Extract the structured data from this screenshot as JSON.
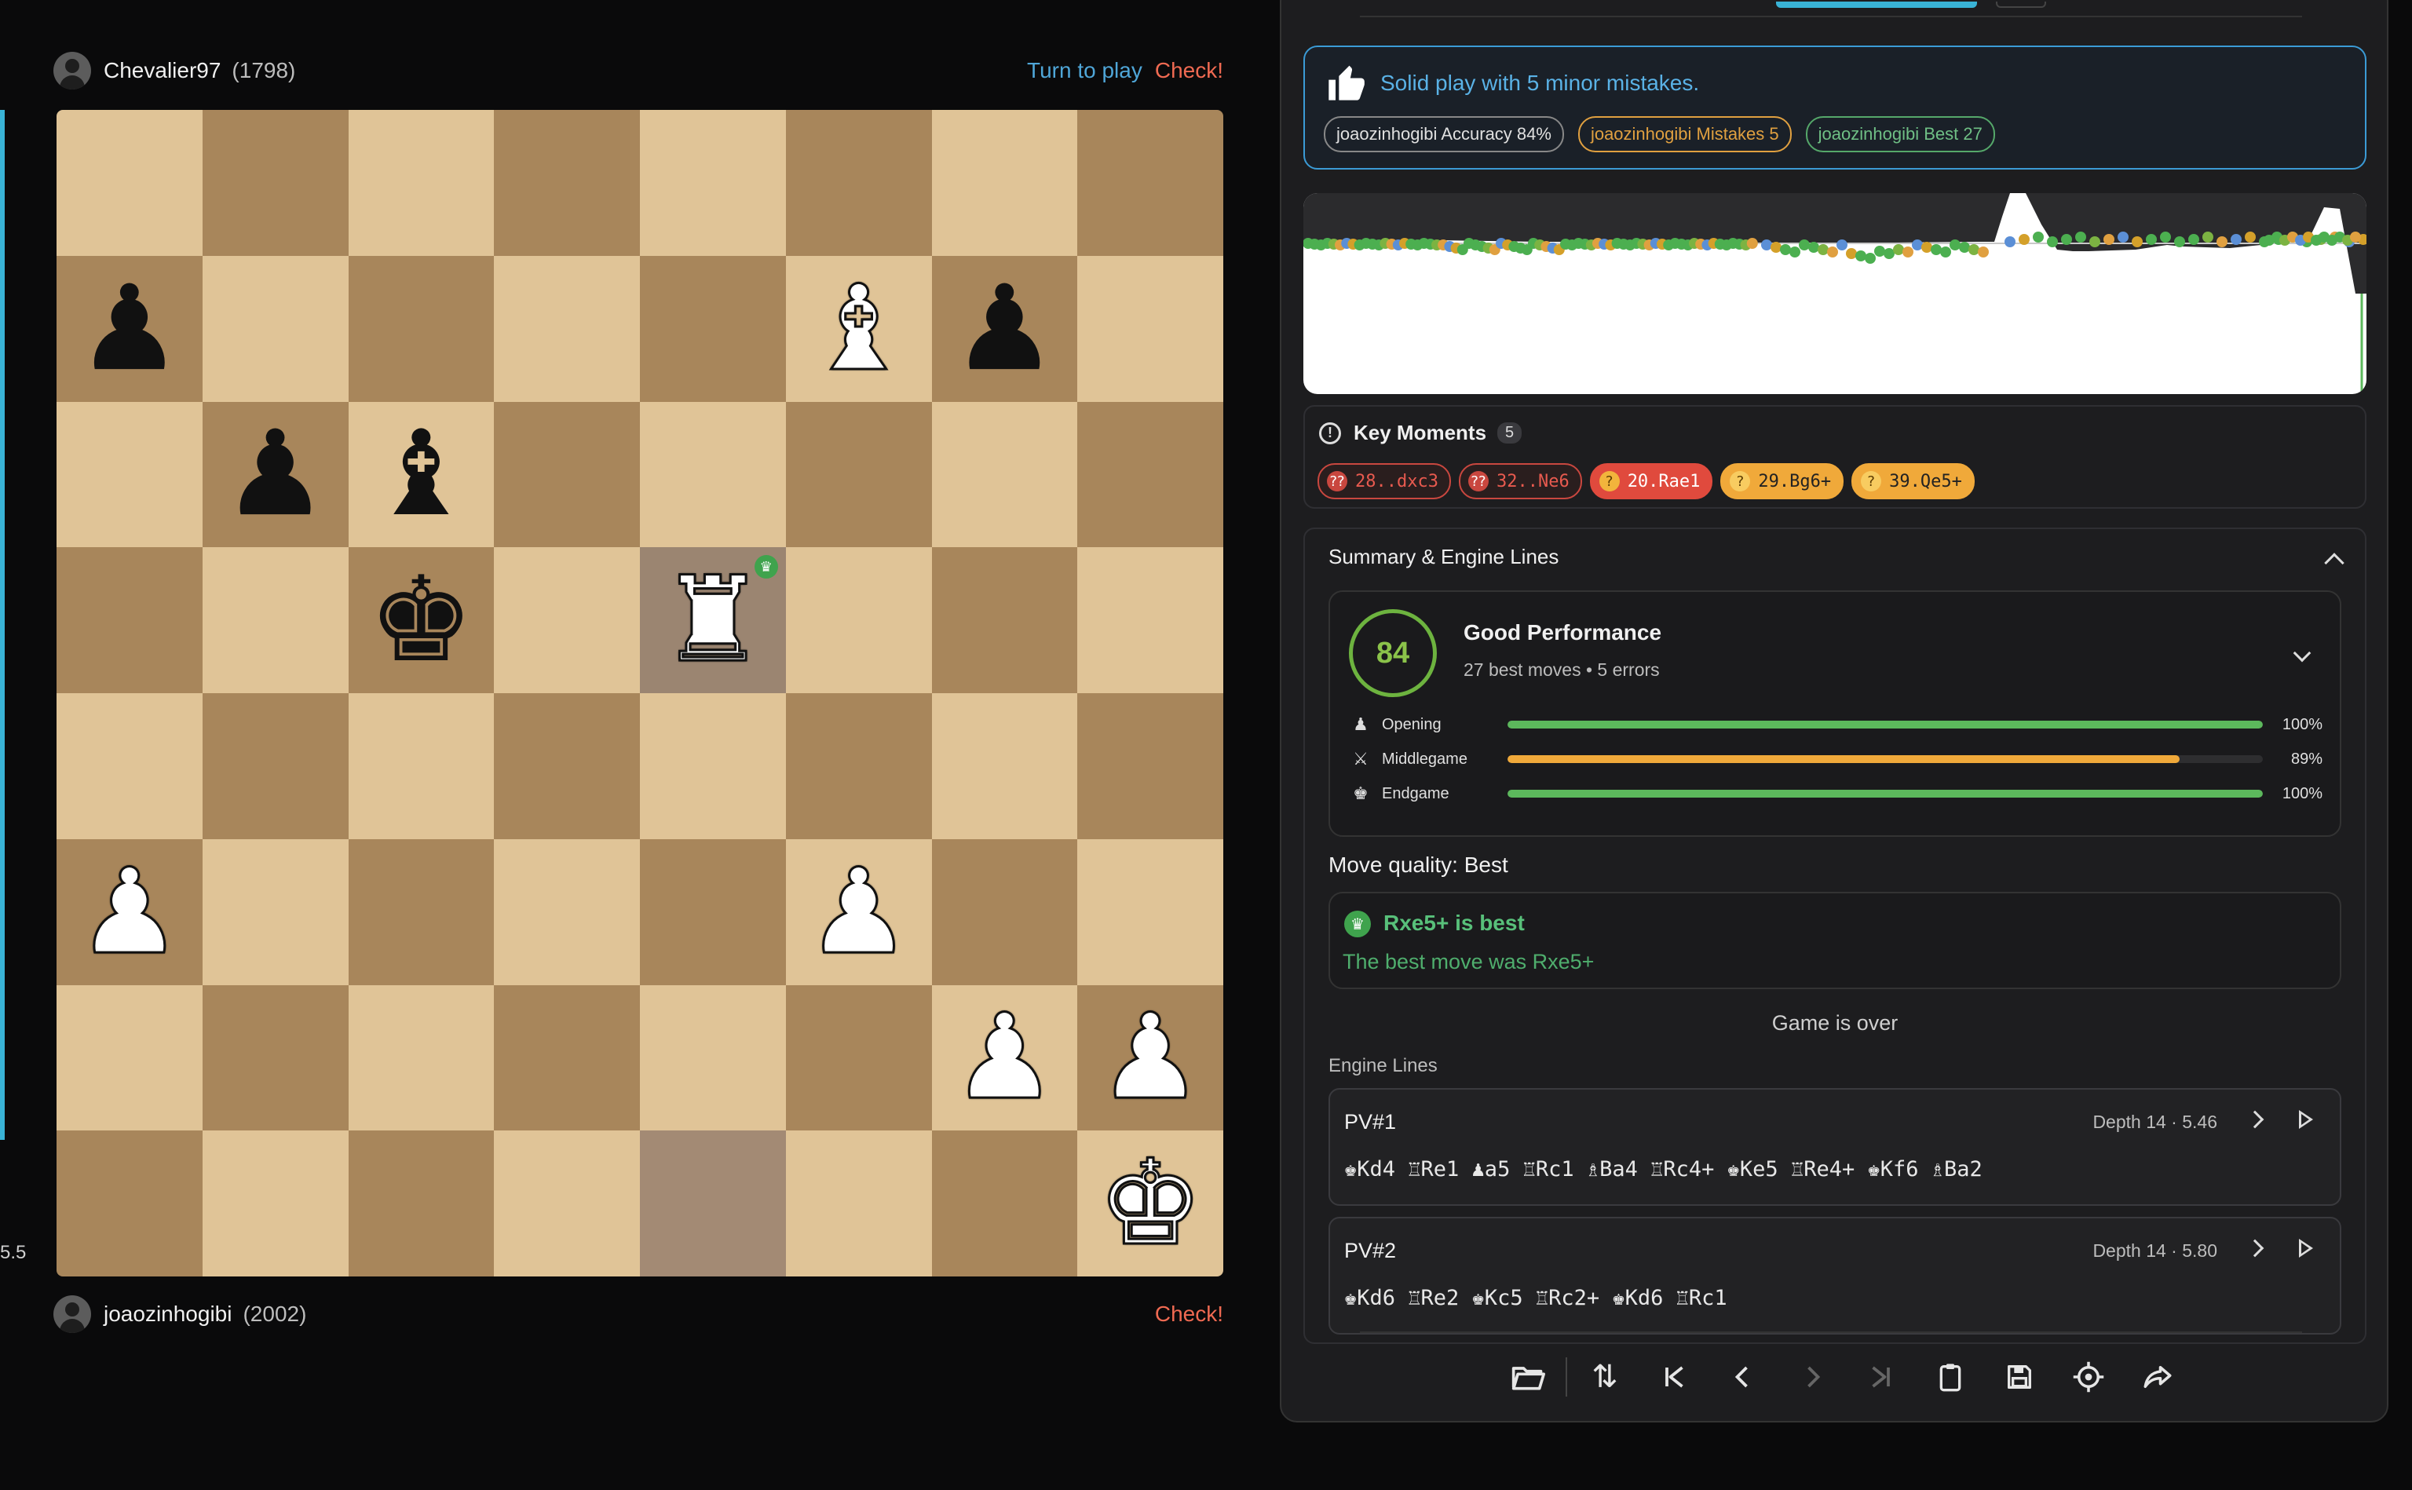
{
  "board_side": {
    "eval_label": "5.5",
    "top_player": {
      "name": "Chevalier97",
      "rating": "(1798)",
      "turn_text": "Turn to play",
      "status": "Check!"
    },
    "bottom_player": {
      "name": "joaozinhogibi",
      "rating": "(2002)",
      "status": "Check!"
    },
    "squares": [
      [
        "",
        "",
        "",
        "",
        "",
        "",
        "",
        ""
      ],
      [
        "bP",
        "",
        "",
        "",
        "",
        "wB",
        "bP",
        ""
      ],
      [
        "",
        "bP",
        "bB",
        "",
        "",
        "",
        "",
        ""
      ],
      [
        "",
        "",
        "bK",
        "",
        "wR*",
        "",
        "",
        ""
      ],
      [
        "",
        "",
        "",
        "",
        "",
        "",
        "",
        ""
      ],
      [
        "wP",
        "",
        "",
        "",
        "",
        "wP",
        "",
        ""
      ],
      [
        "",
        "",
        "",
        "",
        "",
        "",
        "wP",
        "wP"
      ],
      [
        "",
        "",
        "",
        "",
        "hl",
        "",
        "",
        "wK"
      ]
    ]
  },
  "summary": {
    "title": "Solid play with 5 minor mistakes.",
    "chips": [
      "joaozinhogibi Accuracy 84%",
      "joaozinhogibi Mistakes 5",
      "joaozinhogibi Best 27"
    ]
  },
  "key_moments": {
    "title": "Key Moments",
    "count": "5",
    "items": [
      "28..dxc3",
      "32..Ne6",
      "20.Rae1",
      "29.Bg6+",
      "39.Qe5+"
    ]
  },
  "engine_section": {
    "title": "Summary & Engine Lines",
    "score": "84",
    "perf_title": "Good Performance",
    "perf_sub": "27 best moves • 5 errors",
    "phases": [
      {
        "icon": "pawn-icon",
        "label": "Opening",
        "pct": "100%",
        "value": 1.0,
        "color": "#5cb85c"
      },
      {
        "icon": "swords-icon",
        "label": "Middlegame",
        "pct": "89%",
        "value": 0.89,
        "color": "#f0a93a"
      },
      {
        "icon": "king-icon",
        "label": "Endgame",
        "pct": "100%",
        "value": 1.0,
        "color": "#5cb85c"
      }
    ],
    "move_quality": "Move quality: Best",
    "best_title": "Rxe5+ is best",
    "best_sub": "The best move was Rxe5+",
    "game_over": "Game is over",
    "engine_lines_label": "Engine Lines",
    "pv_lines": [
      {
        "name": "PV#1",
        "depth": "Depth 14 · 5.46",
        "moves": "♚Kd4 ♖Re1 ♟a5 ♖Rc1 ♗Ba4 ♖Rc4+ ♚Ke5 ♖Re4+ ♚Kf6 ♗Ba2"
      },
      {
        "name": "PV#2",
        "depth": "Depth 14 · 5.80",
        "moves": "♚Kd6 ♖Re2 ♚Kc5 ♖Rc2+ ♚Kd6 ♖Rc1"
      }
    ]
  },
  "toolbar": {
    "buttons": [
      "open-folder-icon",
      "flip-board-icon",
      "first-move-icon",
      "prev-move-icon",
      "next-move-icon",
      "last-move-icon",
      "clipboard-icon",
      "save-icon",
      "target-icon",
      "share-icon"
    ]
  },
  "colors": {
    "accent": "#39b3d6",
    "check": "#f06a52",
    "best": "#58c07a"
  }
}
